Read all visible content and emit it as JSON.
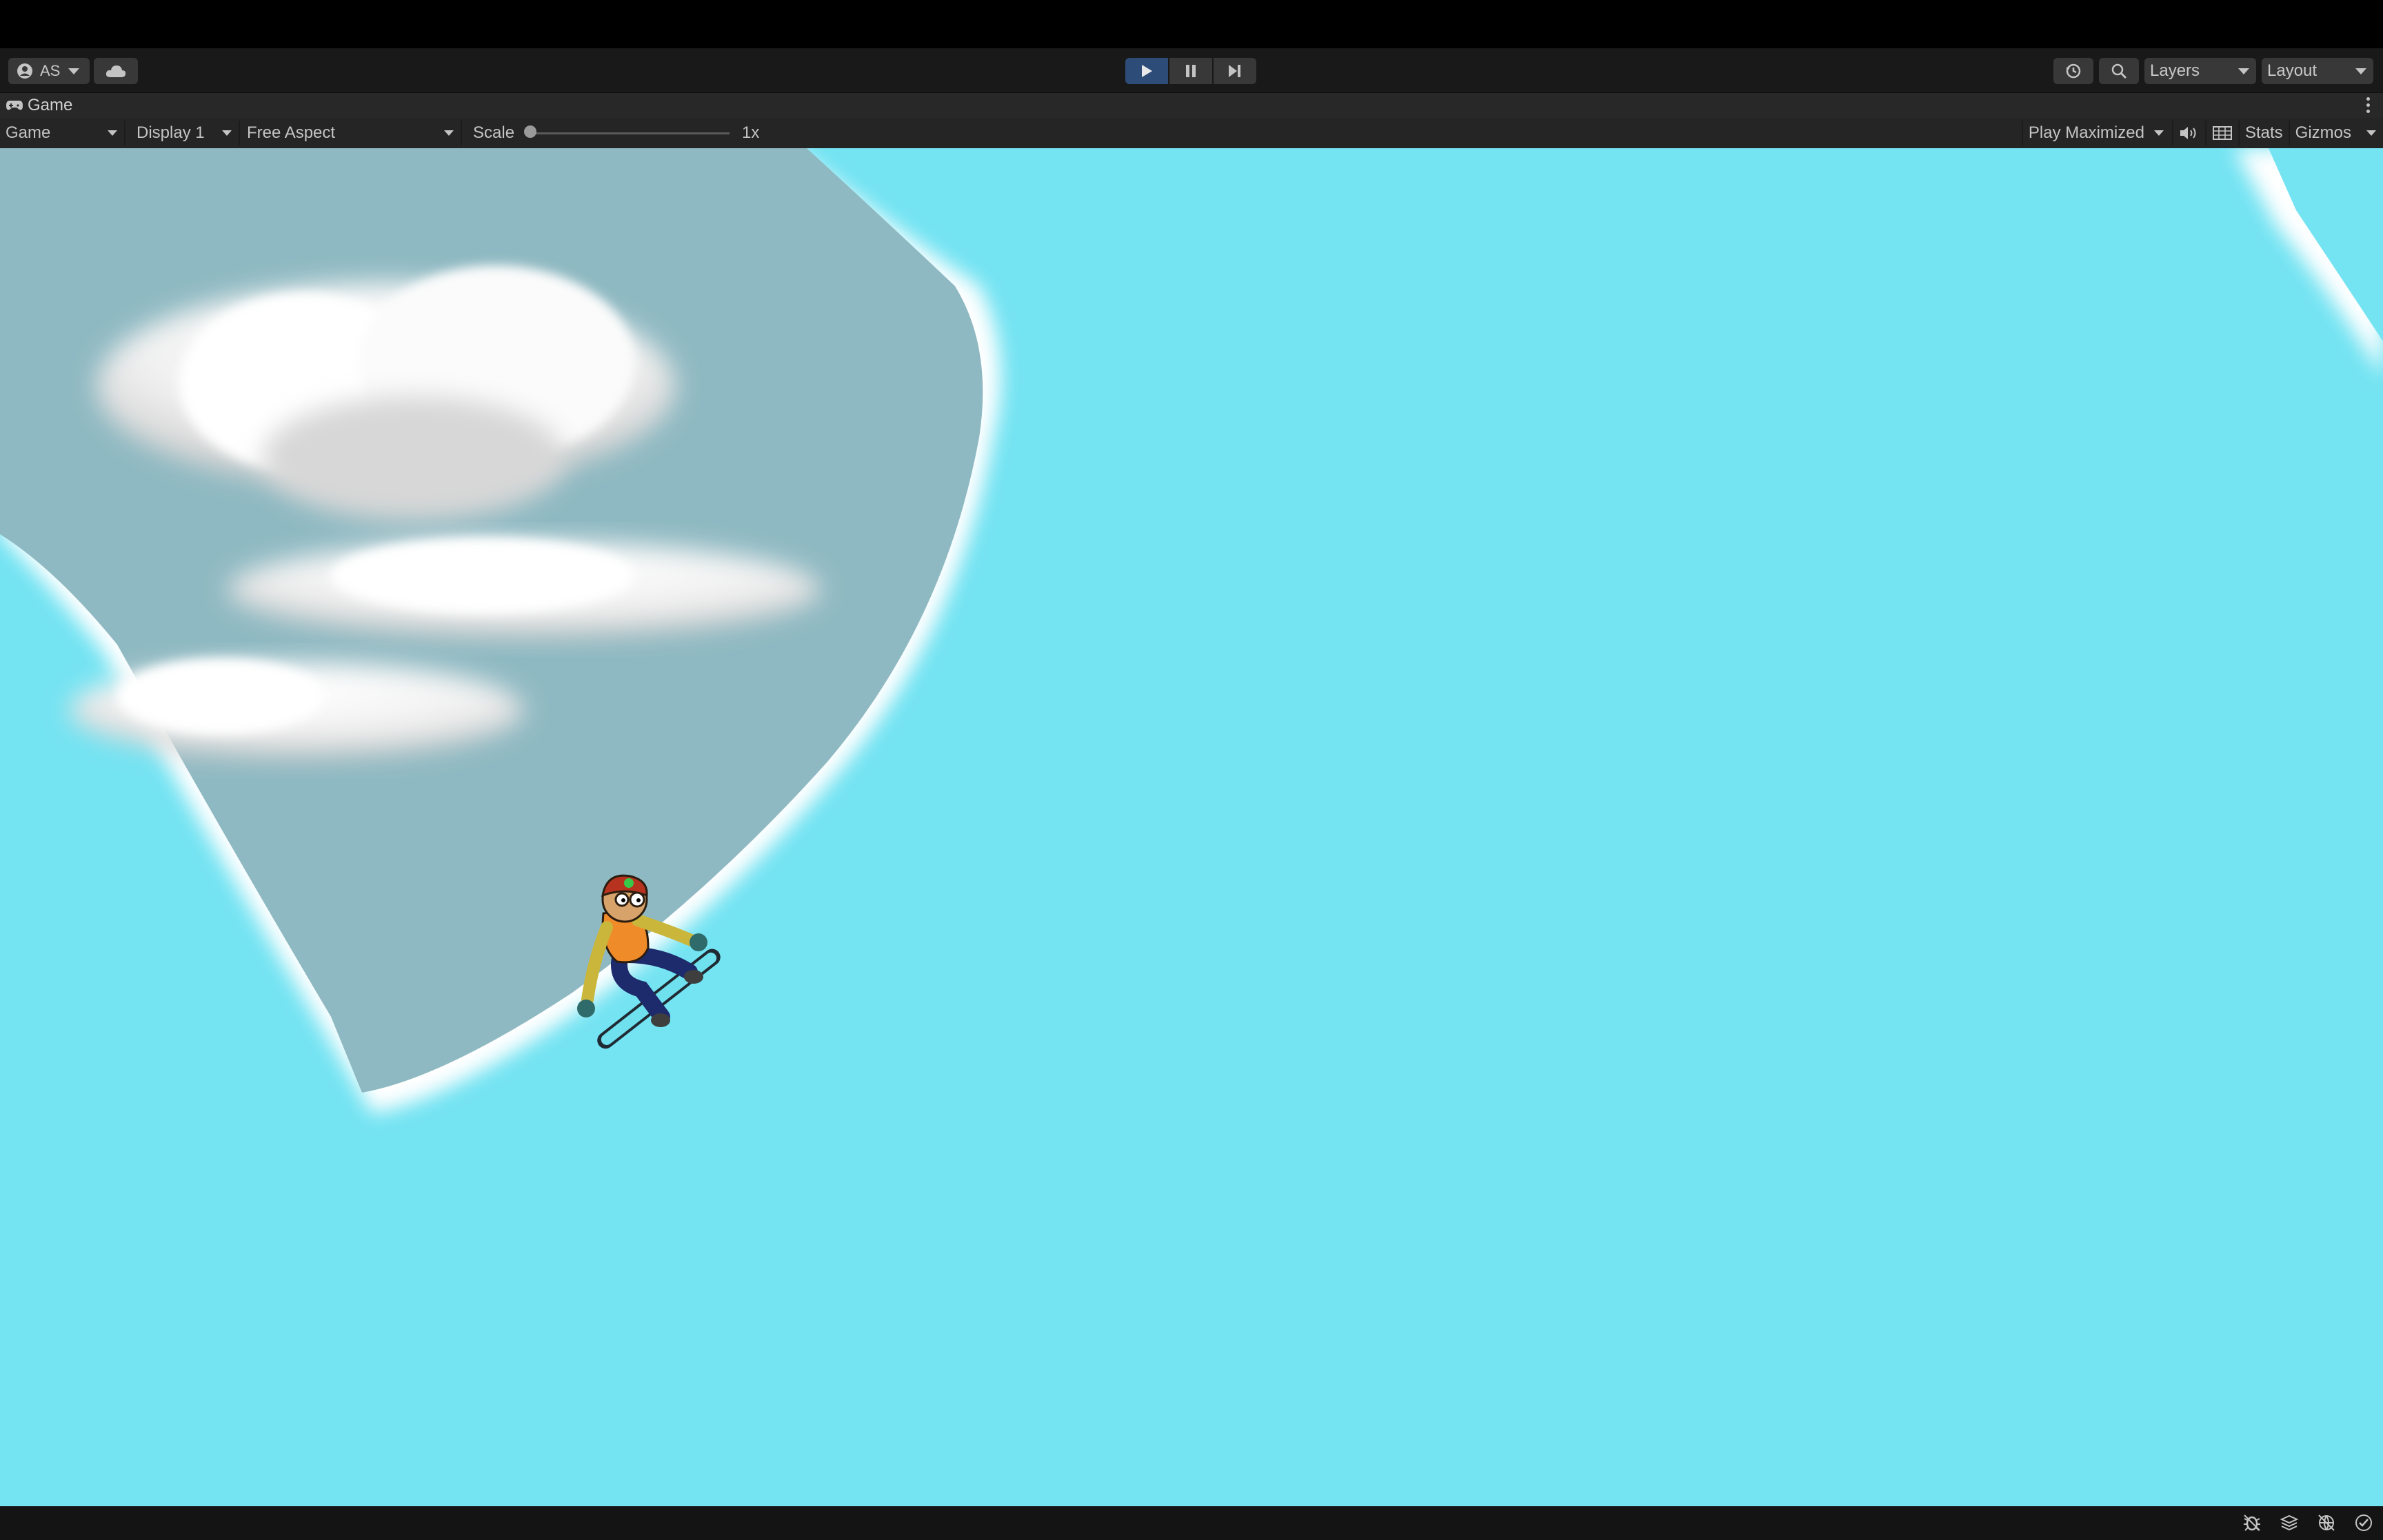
{
  "window": {
    "background": "#000000"
  },
  "topbar": {
    "account_label": "AS",
    "account_icon": "person-icon",
    "cloud_icon": "cloud-icon",
    "play_controls": [
      {
        "name": "play-button",
        "icon": "play-icon",
        "active": true
      },
      {
        "name": "pause-button",
        "icon": "pause-icon",
        "active": false
      },
      {
        "name": "step-button",
        "icon": "step-icon",
        "active": false
      }
    ],
    "history_icon": "history-icon",
    "search_icon": "search-icon",
    "layers_label": "Layers",
    "layout_label": "Layout"
  },
  "game_tab": {
    "title": "Game",
    "icon": "gamepad-icon",
    "menu_icon": "kebab-icon"
  },
  "game_toolbar": {
    "mode": "Game",
    "display": "Display 1",
    "aspect": "Free Aspect",
    "scale_label": "Scale",
    "scale_value": "1x",
    "scale_slider_level": 0.0,
    "play_maximized": "Play Maximized",
    "audio_icon": "speaker-icon",
    "grid_icon": "grid-icon",
    "stats": "Stats",
    "gizmos": "Gizmos"
  },
  "game_view": {
    "sky_color": "#8fb9c2",
    "snow_color": "#74e3f2",
    "edge_color": "#ffffff",
    "character": "snowboarder"
  },
  "statusbar": {
    "icons": [
      "bug-icon",
      "stack-icon",
      "network-icon",
      "check-circle-icon"
    ]
  }
}
